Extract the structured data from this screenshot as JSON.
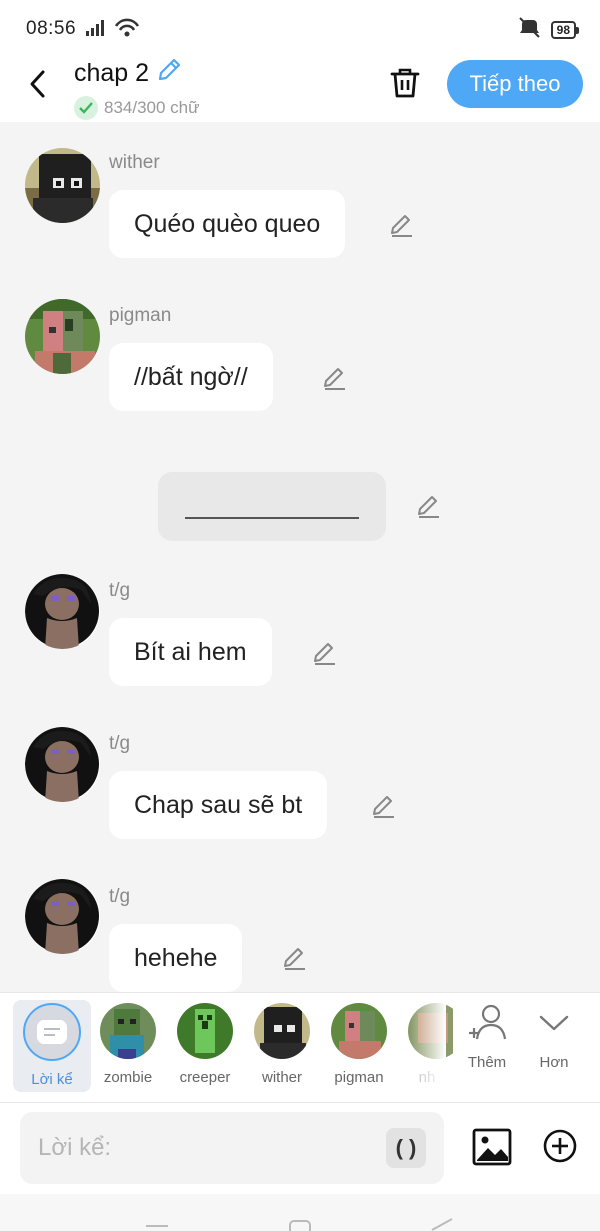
{
  "status_bar": {
    "time": "08:56",
    "battery": "98"
  },
  "header": {
    "title": "chap 2",
    "word_count": "834/300 chữ",
    "next_button": "Tiếp theo"
  },
  "messages": [
    {
      "name": "wither",
      "text": "Quéo quèo queo"
    },
    {
      "name": "pigman",
      "text": "//bất ngờ//"
    },
    {
      "name": "t/g",
      "text": "Bít ai hem"
    },
    {
      "name": "t/g",
      "text": "Chap sau sẽ bt"
    },
    {
      "name": "t/g",
      "text": "hehehe"
    }
  ],
  "characters": [
    {
      "label": "Lời kể",
      "selected": true
    },
    {
      "label": "zombie"
    },
    {
      "label": "creeper"
    },
    {
      "label": "wither"
    },
    {
      "label": "pigman"
    },
    {
      "label": "nh"
    }
  ],
  "actions": {
    "add_label": "Thêm",
    "more_label": "Hơn"
  },
  "input": {
    "placeholder": "Lời kể:",
    "paren": "( )"
  },
  "colors": {
    "accent": "#4fa8f5",
    "check_green": "#3cb55a"
  }
}
